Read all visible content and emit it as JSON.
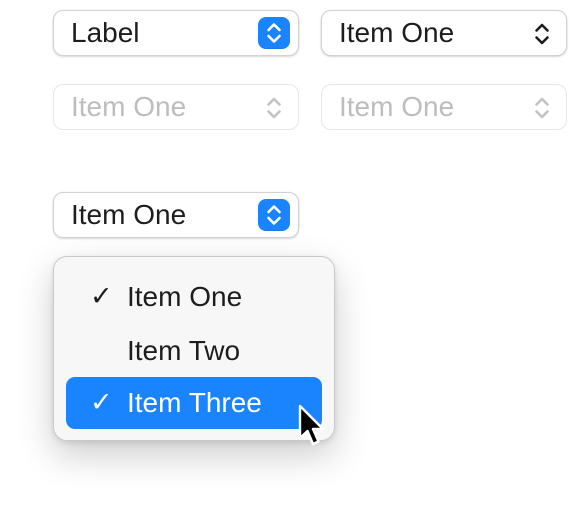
{
  "popups": {
    "label_popup": {
      "value": "Label"
    },
    "item_popup_plain": {
      "value": "Item One"
    },
    "item_popup_disabled_1": {
      "value": "Item One"
    },
    "item_popup_disabled_2": {
      "value": "Item One"
    },
    "item_popup_open": {
      "value": "Item One"
    }
  },
  "menu": {
    "items": [
      {
        "label": "Item One",
        "checked": true
      },
      {
        "label": "Item Two",
        "checked": false
      },
      {
        "label": "Item Three",
        "checked": true,
        "highlighted": true
      }
    ],
    "checkmark": "✓"
  },
  "colors": {
    "accent": "#1a84ff",
    "text": "#1d1d1f",
    "disabled_text": "#bdbdbd",
    "menu_background": "#f7f7f7"
  },
  "icons": {
    "stepper": "chevron-up-down-icon",
    "cursor": "mouse-pointer-icon"
  }
}
